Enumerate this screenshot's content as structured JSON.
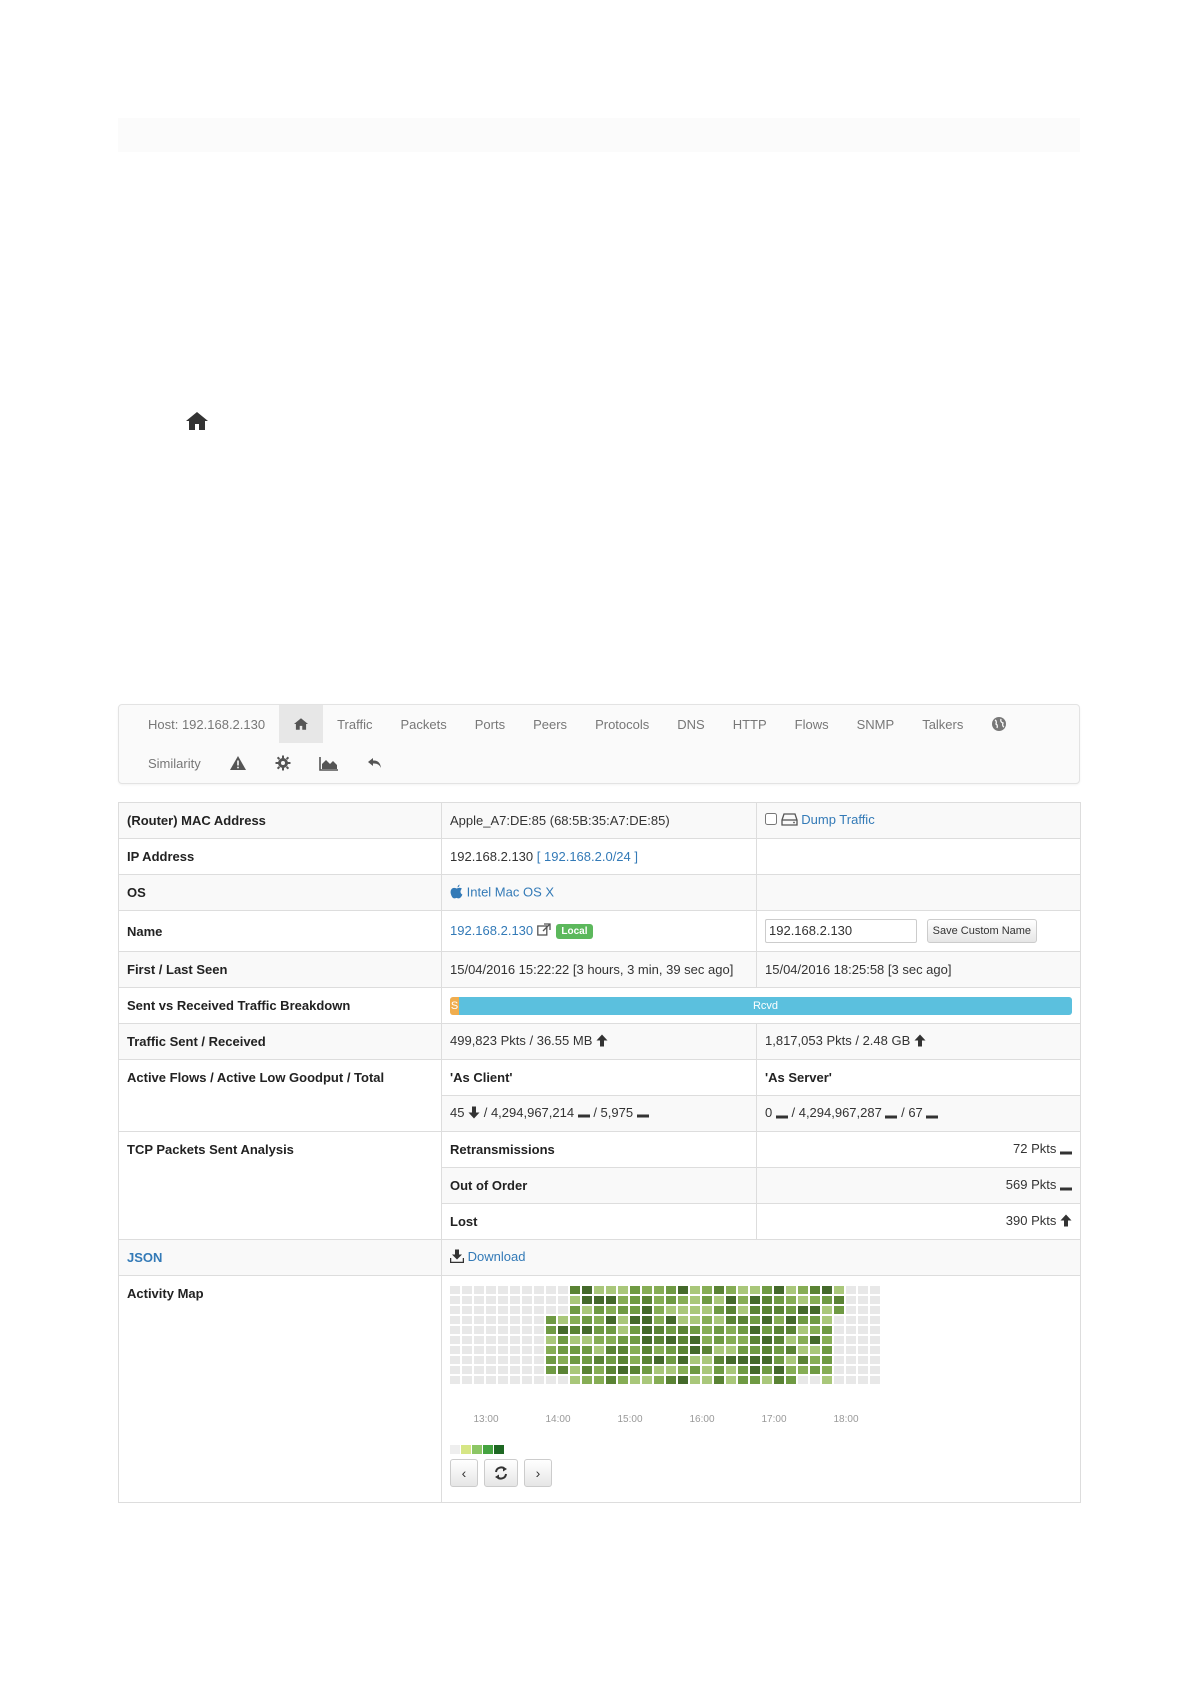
{
  "nav": {
    "host_label": "Host: 192.168.2.130",
    "row1": [
      "Traffic",
      "Packets",
      "Ports",
      "Peers",
      "Protocols",
      "DNS",
      "HTTP",
      "Flows",
      "SNMP",
      "Talkers"
    ],
    "similarity": "Similarity",
    "icons": [
      "home-icon",
      "globe-icon",
      "warning-icon",
      "gear-icon",
      "area-chart-icon",
      "undo-icon"
    ]
  },
  "rows": {
    "mac": {
      "label": "(Router) MAC Address",
      "value": "Apple_A7:DE:85 (68:5B:35:A7:DE:85)",
      "dump": "Dump Traffic"
    },
    "ip": {
      "label": "IP Address",
      "value": "192.168.2.130",
      "open": "[",
      "subnet": "192.168.2.0/24",
      "close": "]"
    },
    "os": {
      "label": "OS",
      "value": "Intel Mac OS X"
    },
    "name": {
      "label": "Name",
      "value": "192.168.2.130",
      "badge": "Local",
      "input_value": "192.168.2.130",
      "save_button": "Save Custom Name"
    },
    "seen": {
      "label": "First / Last Seen",
      "first": "15/04/2016 15:22:22 [3 hours, 3 min, 39 sec ago]",
      "last": "15/04/2016 18:25:58 [3 sec ago]"
    },
    "breakdown": {
      "label": "Sent vs Received Traffic Breakdown",
      "sent_label": "S",
      "rcvd_label": "Rcvd",
      "sent_fraction": 0.0145
    },
    "traffic": {
      "label": "Traffic Sent / Received",
      "sent": "499,823 Pkts / 36.55 MB",
      "rcvd": "1,817,053 Pkts / 2.48 GB"
    },
    "flows": {
      "label": "Active Flows / Active Low Goodput / Total",
      "as_client": "'As Client'",
      "as_server": "'As Server'",
      "client_active": "45",
      "client_low": "/ 4,294,967,214",
      "client_total": "/ 5,975",
      "server_active": "0",
      "server_low": "/ 4,294,967,287",
      "server_total": "/ 67"
    },
    "tcp": {
      "label": "TCP Packets Sent Analysis",
      "retrans": "Retransmissions",
      "retrans_val": "72 Pkts",
      "ooo": "Out of Order",
      "ooo_val": "569 Pkts",
      "lost": "Lost",
      "lost_val": "390 Pkts"
    },
    "json": {
      "label": "JSON",
      "download": "Download"
    },
    "activity": {
      "label": "Activity Map"
    }
  },
  "heatmap": {
    "time_labels": [
      "13:00",
      "14:00",
      "15:00",
      "16:00",
      "17:00",
      "18:00"
    ],
    "colors": [
      "#eeeeee",
      "#d6e685",
      "#8cc665",
      "#44a340",
      "#1e6823"
    ],
    "palette": [
      "#e8e8e8",
      "#a9c77a",
      "#86ad55",
      "#6f9a43",
      "#5a8334",
      "#44692a"
    ]
  }
}
